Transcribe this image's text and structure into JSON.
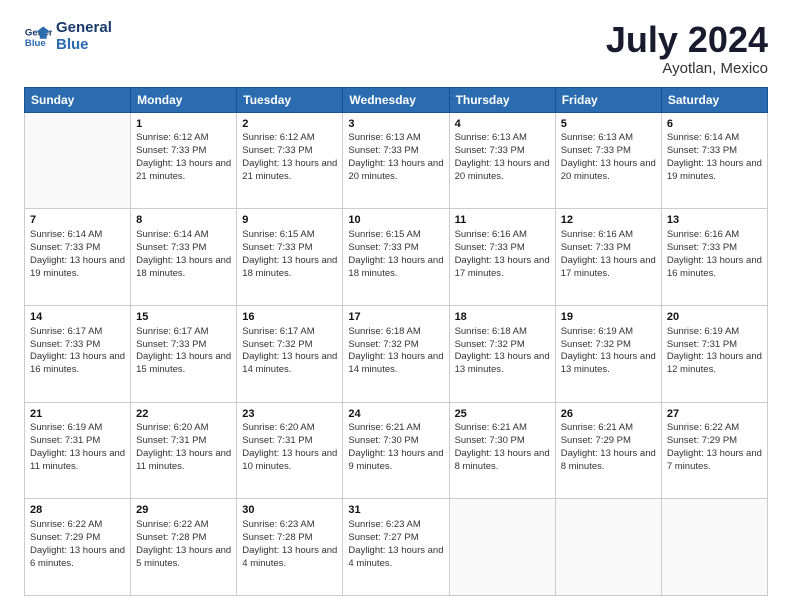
{
  "header": {
    "logo": {
      "line1": "General",
      "line2": "Blue"
    },
    "title": "July 2024",
    "location": "Ayotlan, Mexico"
  },
  "weekdays": [
    "Sunday",
    "Monday",
    "Tuesday",
    "Wednesday",
    "Thursday",
    "Friday",
    "Saturday"
  ],
  "weeks": [
    [
      {
        "day": "",
        "sunrise": "",
        "sunset": "",
        "daylight": "",
        "empty": true
      },
      {
        "day": "1",
        "sunrise": "Sunrise: 6:12 AM",
        "sunset": "Sunset: 7:33 PM",
        "daylight": "Daylight: 13 hours and 21 minutes."
      },
      {
        "day": "2",
        "sunrise": "Sunrise: 6:12 AM",
        "sunset": "Sunset: 7:33 PM",
        "daylight": "Daylight: 13 hours and 21 minutes."
      },
      {
        "day": "3",
        "sunrise": "Sunrise: 6:13 AM",
        "sunset": "Sunset: 7:33 PM",
        "daylight": "Daylight: 13 hours and 20 minutes."
      },
      {
        "day": "4",
        "sunrise": "Sunrise: 6:13 AM",
        "sunset": "Sunset: 7:33 PM",
        "daylight": "Daylight: 13 hours and 20 minutes."
      },
      {
        "day": "5",
        "sunrise": "Sunrise: 6:13 AM",
        "sunset": "Sunset: 7:33 PM",
        "daylight": "Daylight: 13 hours and 20 minutes."
      },
      {
        "day": "6",
        "sunrise": "Sunrise: 6:14 AM",
        "sunset": "Sunset: 7:33 PM",
        "daylight": "Daylight: 13 hours and 19 minutes."
      }
    ],
    [
      {
        "day": "7",
        "sunrise": "Sunrise: 6:14 AM",
        "sunset": "Sunset: 7:33 PM",
        "daylight": "Daylight: 13 hours and 19 minutes."
      },
      {
        "day": "8",
        "sunrise": "Sunrise: 6:14 AM",
        "sunset": "Sunset: 7:33 PM",
        "daylight": "Daylight: 13 hours and 18 minutes."
      },
      {
        "day": "9",
        "sunrise": "Sunrise: 6:15 AM",
        "sunset": "Sunset: 7:33 PM",
        "daylight": "Daylight: 13 hours and 18 minutes."
      },
      {
        "day": "10",
        "sunrise": "Sunrise: 6:15 AM",
        "sunset": "Sunset: 7:33 PM",
        "daylight": "Daylight: 13 hours and 18 minutes."
      },
      {
        "day": "11",
        "sunrise": "Sunrise: 6:16 AM",
        "sunset": "Sunset: 7:33 PM",
        "daylight": "Daylight: 13 hours and 17 minutes."
      },
      {
        "day": "12",
        "sunrise": "Sunrise: 6:16 AM",
        "sunset": "Sunset: 7:33 PM",
        "daylight": "Daylight: 13 hours and 17 minutes."
      },
      {
        "day": "13",
        "sunrise": "Sunrise: 6:16 AM",
        "sunset": "Sunset: 7:33 PM",
        "daylight": "Daylight: 13 hours and 16 minutes."
      }
    ],
    [
      {
        "day": "14",
        "sunrise": "Sunrise: 6:17 AM",
        "sunset": "Sunset: 7:33 PM",
        "daylight": "Daylight: 13 hours and 16 minutes."
      },
      {
        "day": "15",
        "sunrise": "Sunrise: 6:17 AM",
        "sunset": "Sunset: 7:33 PM",
        "daylight": "Daylight: 13 hours and 15 minutes."
      },
      {
        "day": "16",
        "sunrise": "Sunrise: 6:17 AM",
        "sunset": "Sunset: 7:32 PM",
        "daylight": "Daylight: 13 hours and 14 minutes."
      },
      {
        "day": "17",
        "sunrise": "Sunrise: 6:18 AM",
        "sunset": "Sunset: 7:32 PM",
        "daylight": "Daylight: 13 hours and 14 minutes."
      },
      {
        "day": "18",
        "sunrise": "Sunrise: 6:18 AM",
        "sunset": "Sunset: 7:32 PM",
        "daylight": "Daylight: 13 hours and 13 minutes."
      },
      {
        "day": "19",
        "sunrise": "Sunrise: 6:19 AM",
        "sunset": "Sunset: 7:32 PM",
        "daylight": "Daylight: 13 hours and 13 minutes."
      },
      {
        "day": "20",
        "sunrise": "Sunrise: 6:19 AM",
        "sunset": "Sunset: 7:31 PM",
        "daylight": "Daylight: 13 hours and 12 minutes."
      }
    ],
    [
      {
        "day": "21",
        "sunrise": "Sunrise: 6:19 AM",
        "sunset": "Sunset: 7:31 PM",
        "daylight": "Daylight: 13 hours and 11 minutes."
      },
      {
        "day": "22",
        "sunrise": "Sunrise: 6:20 AM",
        "sunset": "Sunset: 7:31 PM",
        "daylight": "Daylight: 13 hours and 11 minutes."
      },
      {
        "day": "23",
        "sunrise": "Sunrise: 6:20 AM",
        "sunset": "Sunset: 7:31 PM",
        "daylight": "Daylight: 13 hours and 10 minutes."
      },
      {
        "day": "24",
        "sunrise": "Sunrise: 6:21 AM",
        "sunset": "Sunset: 7:30 PM",
        "daylight": "Daylight: 13 hours and 9 minutes."
      },
      {
        "day": "25",
        "sunrise": "Sunrise: 6:21 AM",
        "sunset": "Sunset: 7:30 PM",
        "daylight": "Daylight: 13 hours and 8 minutes."
      },
      {
        "day": "26",
        "sunrise": "Sunrise: 6:21 AM",
        "sunset": "Sunset: 7:29 PM",
        "daylight": "Daylight: 13 hours and 8 minutes."
      },
      {
        "day": "27",
        "sunrise": "Sunrise: 6:22 AM",
        "sunset": "Sunset: 7:29 PM",
        "daylight": "Daylight: 13 hours and 7 minutes."
      }
    ],
    [
      {
        "day": "28",
        "sunrise": "Sunrise: 6:22 AM",
        "sunset": "Sunset: 7:29 PM",
        "daylight": "Daylight: 13 hours and 6 minutes."
      },
      {
        "day": "29",
        "sunrise": "Sunrise: 6:22 AM",
        "sunset": "Sunset: 7:28 PM",
        "daylight": "Daylight: 13 hours and 5 minutes."
      },
      {
        "day": "30",
        "sunrise": "Sunrise: 6:23 AM",
        "sunset": "Sunset: 7:28 PM",
        "daylight": "Daylight: 13 hours and 4 minutes."
      },
      {
        "day": "31",
        "sunrise": "Sunrise: 6:23 AM",
        "sunset": "Sunset: 7:27 PM",
        "daylight": "Daylight: 13 hours and 4 minutes."
      },
      {
        "day": "",
        "sunrise": "",
        "sunset": "",
        "daylight": "",
        "empty": true
      },
      {
        "day": "",
        "sunrise": "",
        "sunset": "",
        "daylight": "",
        "empty": true
      },
      {
        "day": "",
        "sunrise": "",
        "sunset": "",
        "daylight": "",
        "empty": true
      }
    ]
  ]
}
